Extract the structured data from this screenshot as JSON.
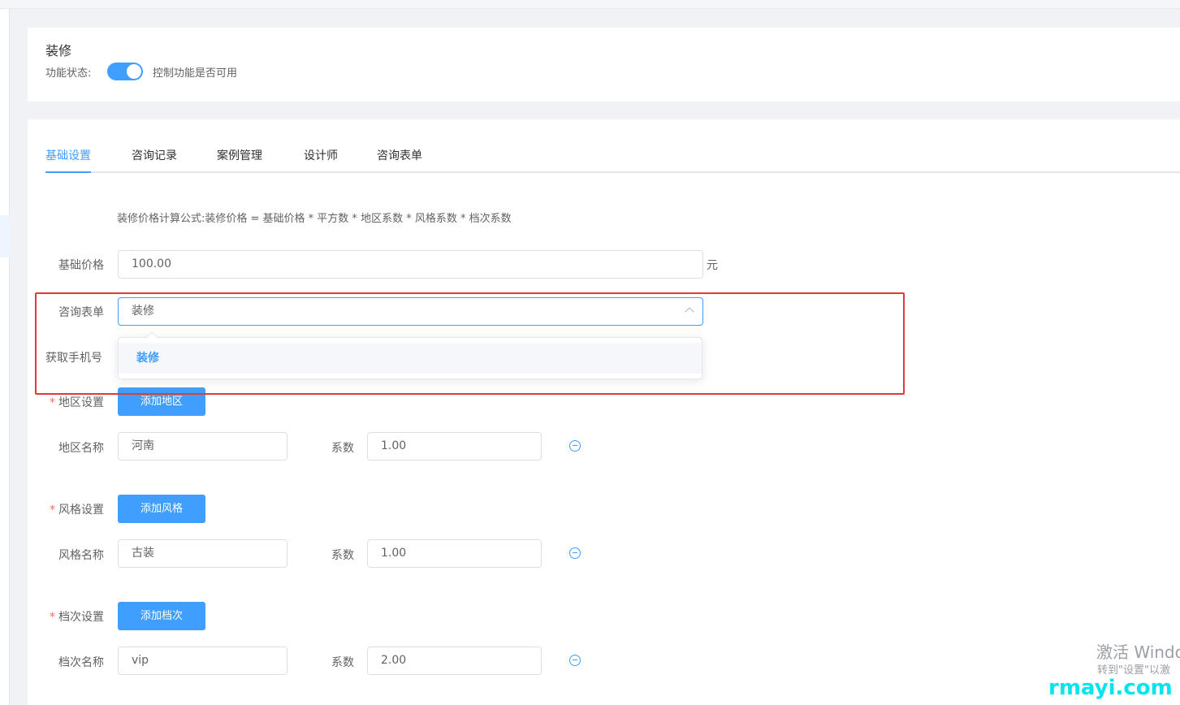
{
  "feature": {
    "title": "装修",
    "state_label": "功能状态:",
    "enabled": true,
    "switch_desc": "控制功能是否可用"
  },
  "tabs": [
    {
      "label": "基础设置",
      "active": true
    },
    {
      "label": "咨询记录",
      "active": false
    },
    {
      "label": "案例管理",
      "active": false
    },
    {
      "label": "设计师",
      "active": false
    },
    {
      "label": "咨询表单",
      "active": false
    }
  ],
  "formula": "装修价格计算公式:装修价格 = 基础价格 * 平方数 * 地区系数 * 风格系数 * 档次系数",
  "base_price": {
    "label": "基础价格",
    "value": "100.00",
    "unit": "元"
  },
  "consult_form": {
    "label": "咨询表单",
    "value": "装修",
    "options": [
      "装修"
    ]
  },
  "get_phone": {
    "label": "获取手机号"
  },
  "coef_label": "系数",
  "region": {
    "label": "地区设置",
    "add_button": "添加地区",
    "name_label": "地区名称",
    "items": [
      {
        "name": "河南",
        "coef": "1.00"
      }
    ]
  },
  "style": {
    "label": "风格设置",
    "add_button": "添加风格",
    "name_label": "风格名称",
    "items": [
      {
        "name": "古装",
        "coef": "1.00"
      }
    ]
  },
  "grade": {
    "label": "档次设置",
    "add_button": "添加档次",
    "name_label": "档次名称",
    "items": [
      {
        "name": "vip",
        "coef": "2.00"
      }
    ]
  },
  "watermark": {
    "line1": "激活 Windo",
    "line2": "转到\"设置\"以激",
    "site": "rmayi.com"
  },
  "colors": {
    "primary": "#409eff",
    "highlight": "#e53935",
    "required": "#f56c6c",
    "site_watermark": "#00e5ee"
  }
}
